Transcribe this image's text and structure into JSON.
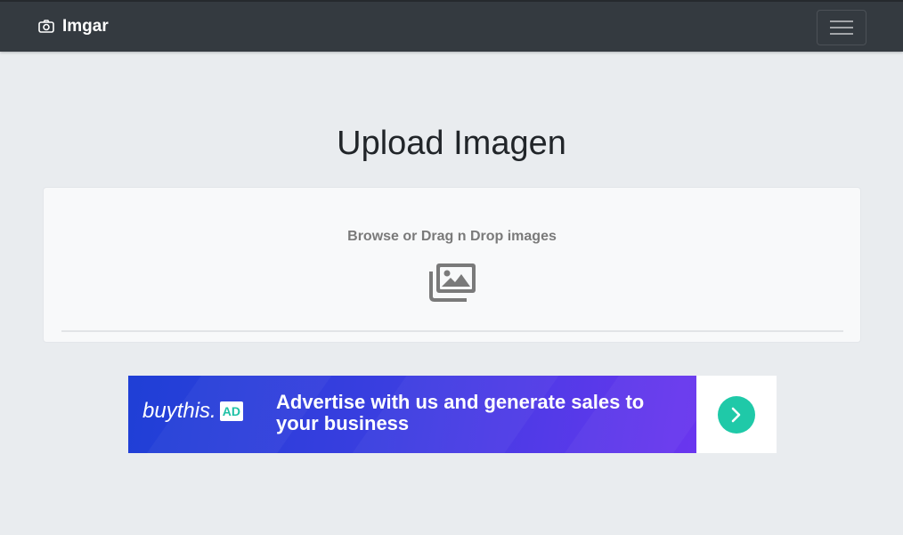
{
  "navbar": {
    "brand_label": "Imgar",
    "brand_icon": "camera-icon",
    "toggler_icon": "hamburger-menu-icon"
  },
  "main": {
    "title": "Upload Imagen",
    "dropzone": {
      "prompt": "Browse or Drag n Drop images",
      "icon": "images-icon"
    }
  },
  "ad": {
    "logo_text": "buythis",
    "logo_dot": ".",
    "logo_badge": "AD",
    "headline": "Advertise with us and generate sales to your business",
    "arrow_icon": "chevron-right-icon"
  },
  "colors": {
    "navbar_bg": "#343a40",
    "page_bg": "#e9ecef",
    "ad_accent": "#1fc9a8"
  }
}
